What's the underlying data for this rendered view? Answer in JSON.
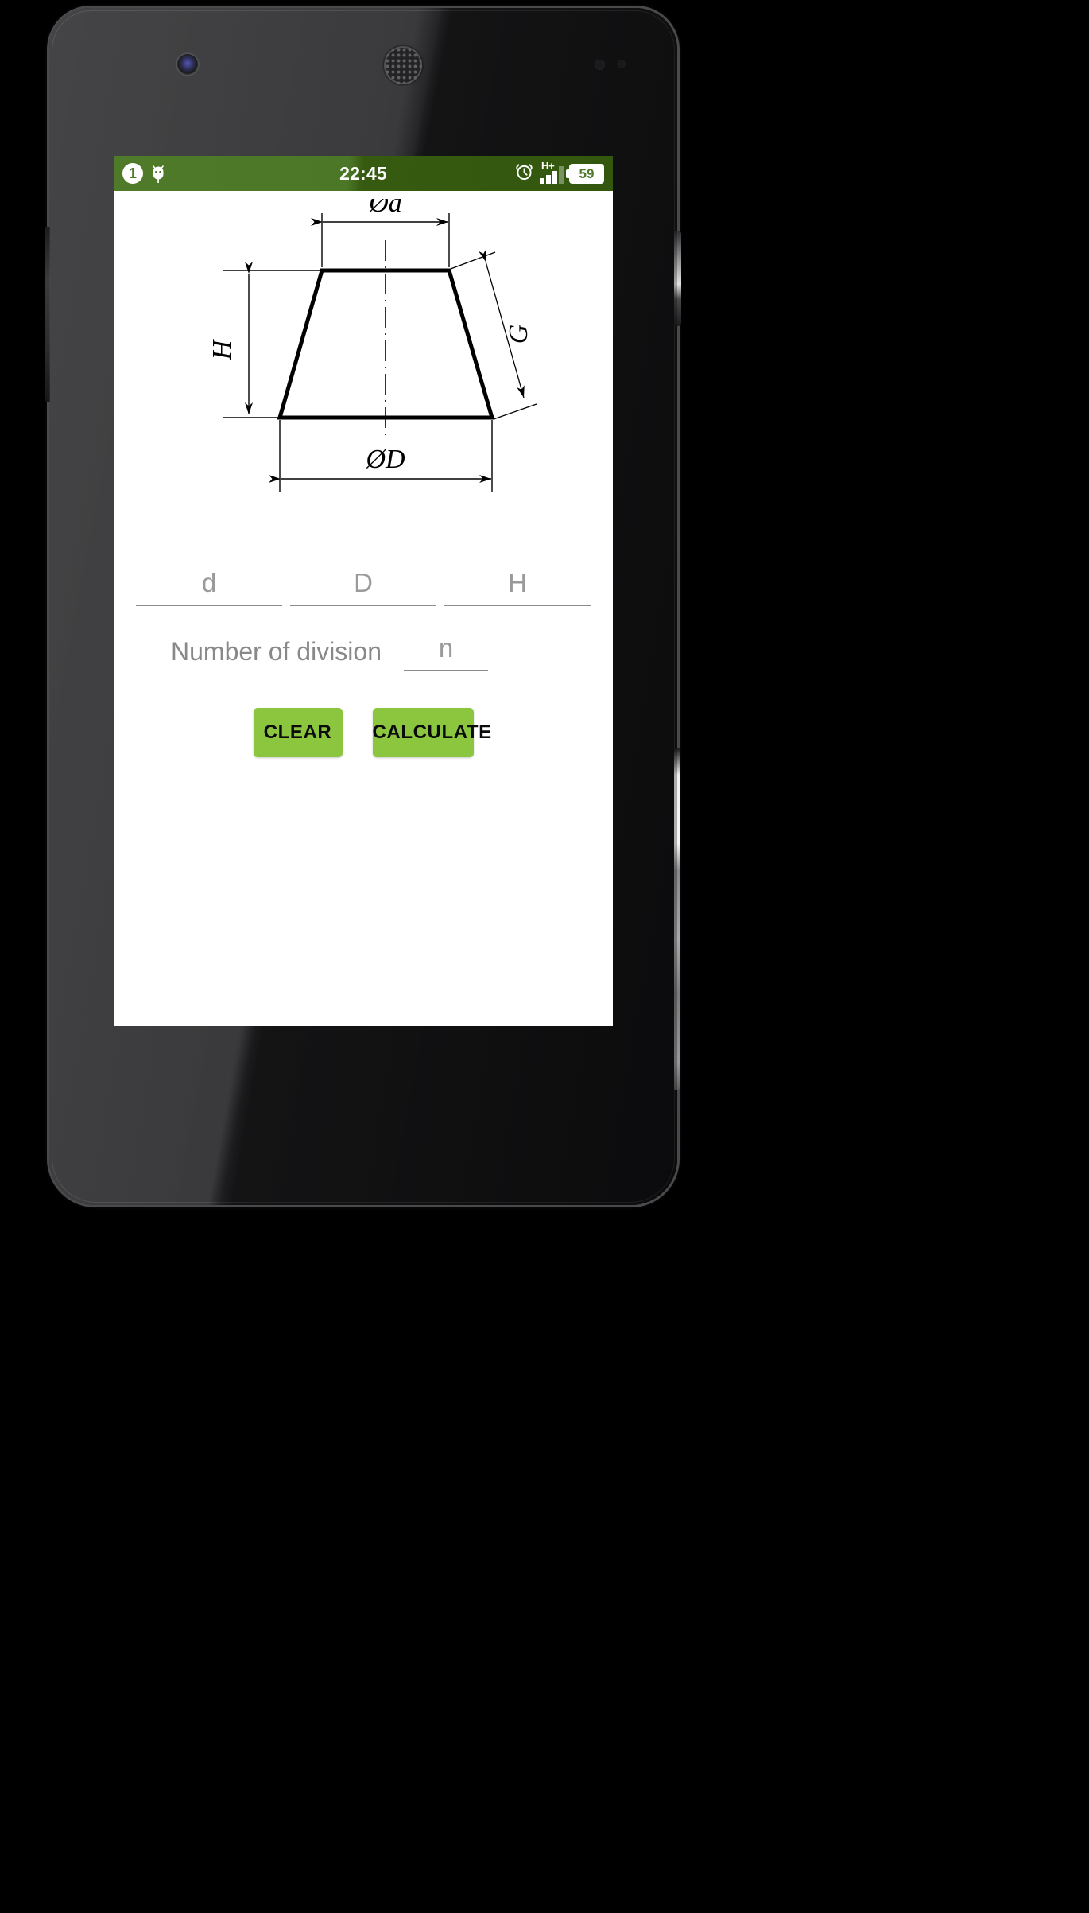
{
  "status_bar": {
    "notification_count": "1",
    "bug_icon": "android-bug-icon",
    "clock": "22:45",
    "alarm_icon": "alarm-clock-icon",
    "network_type": "H+",
    "signal_bars_filled": 3,
    "signal_bars_total": 4,
    "battery_level": "59",
    "background_color": "#4e7a29",
    "text_color": "#ffffff"
  },
  "diagram": {
    "name": "truncated-cone-frustum-diagram",
    "labels": {
      "top_diameter": "ød",
      "bottom_diameter": "øD",
      "height": "H",
      "slant": "G"
    }
  },
  "form": {
    "dimension_fields": [
      {
        "name": "d",
        "placeholder": "d",
        "value": ""
      },
      {
        "name": "D",
        "placeholder": "D",
        "value": ""
      },
      {
        "name": "H",
        "placeholder": "H",
        "value": ""
      }
    ],
    "division": {
      "label": "Number of division",
      "placeholder": "n",
      "value": ""
    }
  },
  "buttons": {
    "clear_label": "CLEAR",
    "calculate_label": "CALCULATE",
    "accent_color": "#8cc63f",
    "text_color": "#0b0b0b"
  }
}
